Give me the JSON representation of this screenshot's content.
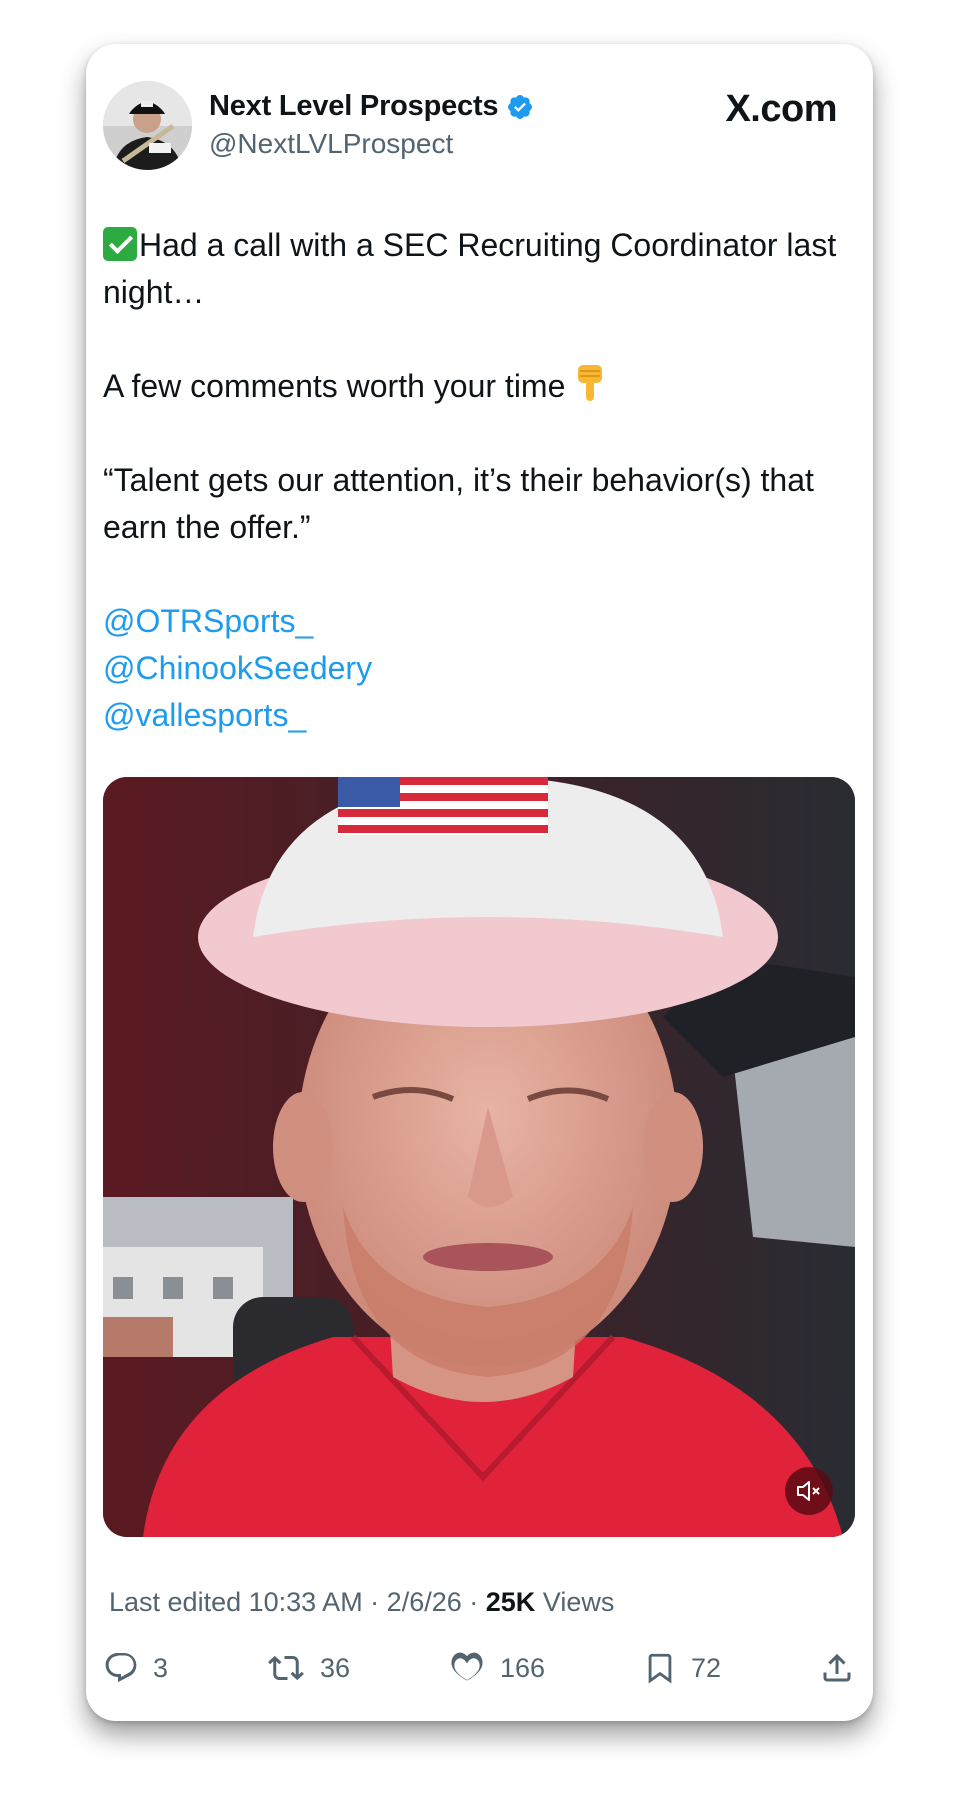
{
  "author": {
    "name": "Next Level Prospects",
    "handle": "@NextLVLProspect",
    "verified": true
  },
  "site_label": "X.com",
  "tweet": {
    "line1": "Had a call with a SEC Recruiting Coordinator last night…",
    "line2": "A few comments worth your time",
    "quote": "“Talent gets our attention, it’s their behavior(s) that earn the offer.”",
    "mentions": [
      "@OTRSports_",
      "@ChinookSeedery",
      "@vallesports_"
    ]
  },
  "media": {
    "type": "video",
    "muted": true
  },
  "meta": {
    "edited": "Last edited 10:33 AM · 2/6/26",
    "separator": " · ",
    "views_count": "25K",
    "views_label": "Views"
  },
  "actions": {
    "replies": "3",
    "reposts": "36",
    "likes": "166",
    "bookmarks": "72"
  },
  "colors": {
    "link": "#1d9bf0",
    "verified": "#1d9bf0",
    "secondary_text": "#536471",
    "primary_text": "#0f1419"
  },
  "icons": {
    "verified": "verified-badge-icon",
    "check": "check-mark-emoji",
    "point": "backhand-index-pointing-down-emoji",
    "mute": "speaker-muted-icon",
    "reply": "reply-bubble-icon",
    "repost": "repost-icon",
    "like": "heart-icon",
    "bookmark": "bookmark-icon",
    "share": "share-icon"
  }
}
